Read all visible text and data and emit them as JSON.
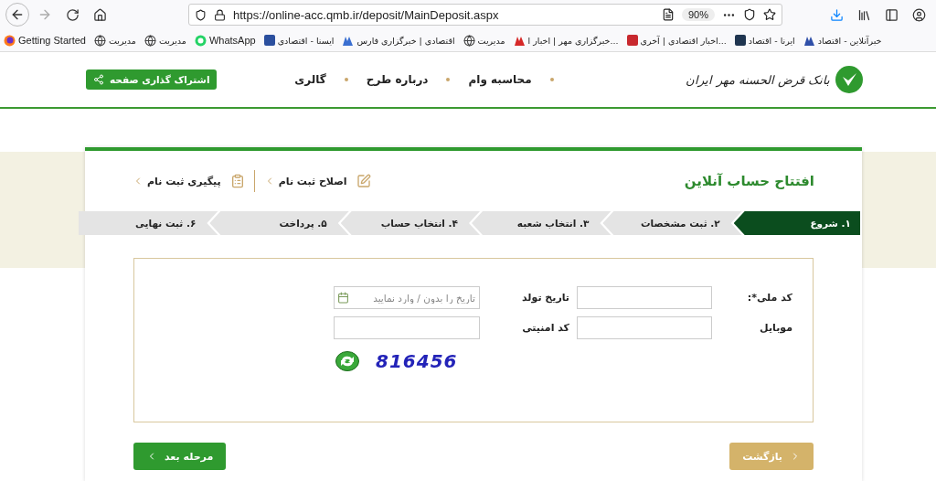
{
  "browser": {
    "url": "https://online-acc.qmb.ir/deposit/MainDeposit.aspx",
    "zoom": "90%",
    "bookmarks": [
      {
        "label": "خبرآنلاین - اقتصاد",
        "kind": "figure",
        "color": "#2f4fa8"
      },
      {
        "label": "ایرنا - اقتصاد",
        "kind": "tile",
        "color": "#1f3550"
      },
      {
        "label": "اخبار اقتصادی | آخری...",
        "kind": "tile",
        "color": "#c8282e"
      },
      {
        "label": "خبرگزاری مهر | اخبار ا...",
        "kind": "figure",
        "color": "#d62828"
      },
      {
        "label": "مدیریت",
        "kind": "globe"
      },
      {
        "label": "اقتصادی | خبرگزاری فارس",
        "kind": "figure",
        "color": "#3a6fd1"
      },
      {
        "label": "ایسنا - اقتصادی",
        "kind": "tile",
        "color": "#2b4f9e"
      },
      {
        "label": "WhatsApp",
        "kind": "whatsapp"
      },
      {
        "label": "مدیریت",
        "kind": "globe"
      },
      {
        "label": "مدیریت",
        "kind": "globe"
      },
      {
        "label": "Getting Started",
        "kind": "firefox"
      }
    ]
  },
  "header": {
    "logo_text": "بانک قرض الحسنه مهر ایران",
    "nav": [
      "محاسبه وام",
      "درباره طرح",
      "گالری"
    ],
    "share_button": "اشتراک گذاری صفحه"
  },
  "card": {
    "title": "افتتاح حساب آنلاین",
    "links": [
      {
        "label": "اصلاح ثبت نام",
        "kind": "edit"
      },
      {
        "label": "پیگیری ثبت نام",
        "kind": "track"
      }
    ],
    "steps": [
      {
        "label": "۱. شروع",
        "selected": true
      },
      {
        "label": "۲. ثبت مشخصات",
        "selected": false
      },
      {
        "label": "۳. انتخاب شعبه",
        "selected": false
      },
      {
        "label": "۴. انتخاب حساب",
        "selected": false
      },
      {
        "label": "۵. پرداخت",
        "selected": false
      },
      {
        "label": "۶. ثبت نهایی",
        "selected": false
      }
    ],
    "fields": [
      {
        "label": "کد ملی*:",
        "kind": "text"
      },
      {
        "label": "تاریخ تولد",
        "kind": "date",
        "placeholder": "تاریخ را بدون / وارد نمایید"
      },
      {
        "label": "موبایل",
        "kind": "text"
      },
      {
        "label": "کد امنیتی",
        "kind": "text"
      }
    ],
    "captcha": "816456",
    "buttons": [
      {
        "label": "بازگشت",
        "kind": "back"
      },
      {
        "label": "مرحله بعد",
        "kind": "next"
      }
    ]
  }
}
